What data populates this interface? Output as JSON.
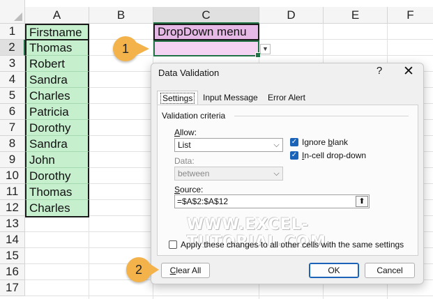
{
  "columns": [
    "A",
    "B",
    "C",
    "D",
    "E",
    "F"
  ],
  "rows": [
    "1",
    "2",
    "3",
    "4",
    "5",
    "6",
    "7",
    "8",
    "9",
    "10",
    "11",
    "12",
    "13",
    "14",
    "15",
    "16",
    "17"
  ],
  "column_a": [
    "Firstname",
    "Thomas",
    "Robert",
    "Sandra",
    "Charles",
    "Patricia",
    "Dorothy",
    "Sandra",
    "John",
    "Dorothy",
    "Thomas",
    "Charles"
  ],
  "cell_c1": "DropDown menu",
  "badges": {
    "one": "1",
    "two": "2"
  },
  "dialog": {
    "title": "Data Validation",
    "help": "?",
    "close": "✕",
    "tabs": [
      "Settings",
      "Input Message",
      "Error Alert"
    ],
    "section": "Validation criteria",
    "allow_label_u": "A",
    "allow_label_rest": "llow:",
    "allow_value": "List",
    "ignore_blank_pre": "Ignore ",
    "ignore_blank_u": "b",
    "ignore_blank_post": "lank",
    "incell_pre": "",
    "incell_u": "I",
    "incell_post": "n-cell drop-down",
    "data_label": "Data:",
    "data_value": "between",
    "source_label_u": "S",
    "source_label_rest": "ource:",
    "source_value": "=$A$2:$A$12",
    "apply_pre": "Apply these changes to all other cells with the same settings",
    "clear_u": "C",
    "clear_rest": "lear All",
    "ok": "OK",
    "cancel": "Cancel"
  },
  "watermark": "WWW.EXCEL-TUTORIAL.COM",
  "colors": {
    "green_fill": "#c6efce",
    "pink_header": "#e6b8e6",
    "pink_cell": "#f3d2f2",
    "badge": "#f4b24a",
    "accent": "#1a63b8"
  }
}
